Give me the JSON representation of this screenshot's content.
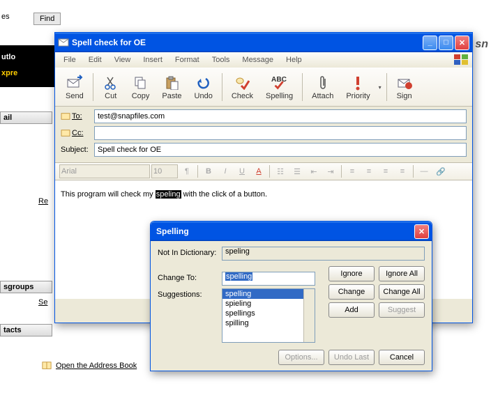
{
  "bg": {
    "menuItem1": "es",
    "menuItem2": "Find",
    "logoTop": "utlo",
    "logoBot": "xpre",
    "sidebar_mail": "ail",
    "sidebar_link1": "Re",
    "sidebar_groups": "sgroups",
    "sidebar_link2": "Se",
    "sidebar_contacts": "tacts",
    "addressbook": "Open the Address Book",
    "msn": "sn"
  },
  "compose": {
    "title": "Spell check for OE",
    "menu": {
      "file": "File",
      "edit": "Edit",
      "view": "View",
      "insert": "Insert",
      "format": "Format",
      "tools": "Tools",
      "message": "Message",
      "help": "Help"
    },
    "toolbar": {
      "send": "Send",
      "cut": "Cut",
      "copy": "Copy",
      "paste": "Paste",
      "undo": "Undo",
      "check": "Check",
      "spelling": "Spelling",
      "attach": "Attach",
      "priority": "Priority",
      "sign": "Sign"
    },
    "labels": {
      "to": "To:",
      "cc": "Cc:",
      "subject": "Subject:"
    },
    "fields": {
      "to": "test@snapfiles.com",
      "cc": "",
      "subject": "Spell check for OE"
    },
    "format": {
      "font": "Arial",
      "size": "10"
    },
    "body": {
      "before": "This program will check my ",
      "highlight": "speling",
      "after": " with the click of a button."
    }
  },
  "spell": {
    "title": "Spelling",
    "labels": {
      "notindict": "Not In Dictionary:",
      "changeto": "Change To:",
      "suggestions": "Suggestions:"
    },
    "notindict_value": "speling",
    "changeto_value": "spelling",
    "suggestions": [
      "spelling",
      "spieling",
      "spellings",
      "spilling"
    ],
    "buttons": {
      "ignore": "Ignore",
      "ignoreall": "Ignore All",
      "change": "Change",
      "changeall": "Change All",
      "add": "Add",
      "suggest": "Suggest",
      "options": "Options...",
      "undolast": "Undo Last",
      "cancel": "Cancel"
    }
  }
}
